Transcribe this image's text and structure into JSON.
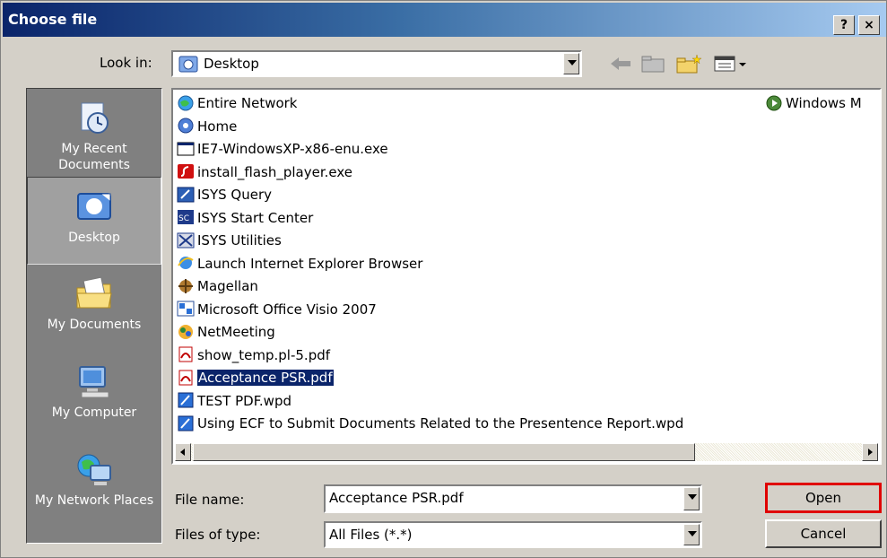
{
  "window": {
    "title": "Choose file",
    "help_label": "?",
    "close_label": "×"
  },
  "look_in": {
    "label": "Look in:",
    "value": "Desktop"
  },
  "places": [
    {
      "label": "My Recent Documents"
    },
    {
      "label": "Desktop"
    },
    {
      "label": "My Documents"
    },
    {
      "label": "My Computer"
    },
    {
      "label": "My Network Places"
    }
  ],
  "files": [
    {
      "name": "Entire Network",
      "icon": "network-icon"
    },
    {
      "name": "Home",
      "icon": "shortcut-icon"
    },
    {
      "name": "IE7-WindowsXP-x86-enu.exe",
      "icon": "exe-icon"
    },
    {
      "name": "install_flash_player.exe",
      "icon": "flash-icon"
    },
    {
      "name": "ISYS Query",
      "icon": "isys-icon"
    },
    {
      "name": "ISYS Start Center",
      "icon": "isys-sc-icon"
    },
    {
      "name": "ISYS Utilities",
      "icon": "tools-icon"
    },
    {
      "name": "Launch Internet Explorer Browser",
      "icon": "ie-icon"
    },
    {
      "name": "Magellan",
      "icon": "magellan-icon"
    },
    {
      "name": "Microsoft Office Visio 2007",
      "icon": "visio-icon"
    },
    {
      "name": "NetMeeting",
      "icon": "netmeeting-icon"
    },
    {
      "name": "show_temp.pl-5.pdf",
      "icon": "pdf-icon"
    },
    {
      "name": "Acceptance PSR.pdf",
      "icon": "pdf-icon",
      "selected": true
    },
    {
      "name": "TEST PDF.wpd",
      "icon": "wpd-icon"
    },
    {
      "name": "Using ECF to Submit Documents Related to the Presentence Report.wpd",
      "icon": "wpd-icon"
    }
  ],
  "files_col2": [
    {
      "name": "Windows M",
      "icon": "media-icon"
    }
  ],
  "file_name": {
    "label": "File name:",
    "value": "Acceptance PSR.pdf"
  },
  "file_type": {
    "label": "Files of type:",
    "value": "All Files (*.*)"
  },
  "buttons": {
    "open": "Open",
    "cancel": "Cancel"
  },
  "colors": {
    "titlebar": "#0a246a",
    "selection": "#0a246a",
    "highlight": "#e00000"
  }
}
